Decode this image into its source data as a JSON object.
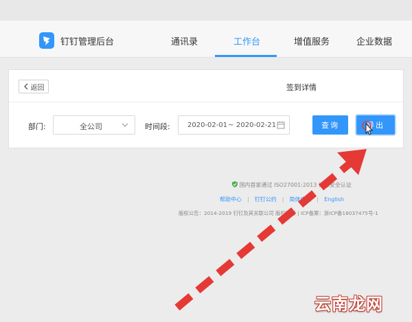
{
  "header": {
    "brand": "钉钉管理后台",
    "nav": [
      "通讯录",
      "工作台",
      "增值服务",
      "企业数据"
    ],
    "active_index": 1
  },
  "detail": {
    "back_label": "返回",
    "title": "签到详情",
    "department_label": "部门:",
    "department_value": "全公司",
    "period_label": "时间段:",
    "date_start": "2020-02-01",
    "date_sep": "~",
    "date_end": "2020-02-21",
    "query_button": "查询",
    "export_button": "导出"
  },
  "footer": {
    "certification": "国内首家通过 ISO27001:2013 信息安全认证",
    "links": [
      "帮助中心",
      "钉钉公约",
      "简体中文",
      "English"
    ],
    "copyright": "版权公告：2014-2019 钉钉及其关联公司 版权所有 | ICP备案：浙ICP备18037475号-1"
  },
  "watermark": "云南龙网",
  "colors": {
    "accent": "#3296fa",
    "arrow": "#e53935"
  }
}
